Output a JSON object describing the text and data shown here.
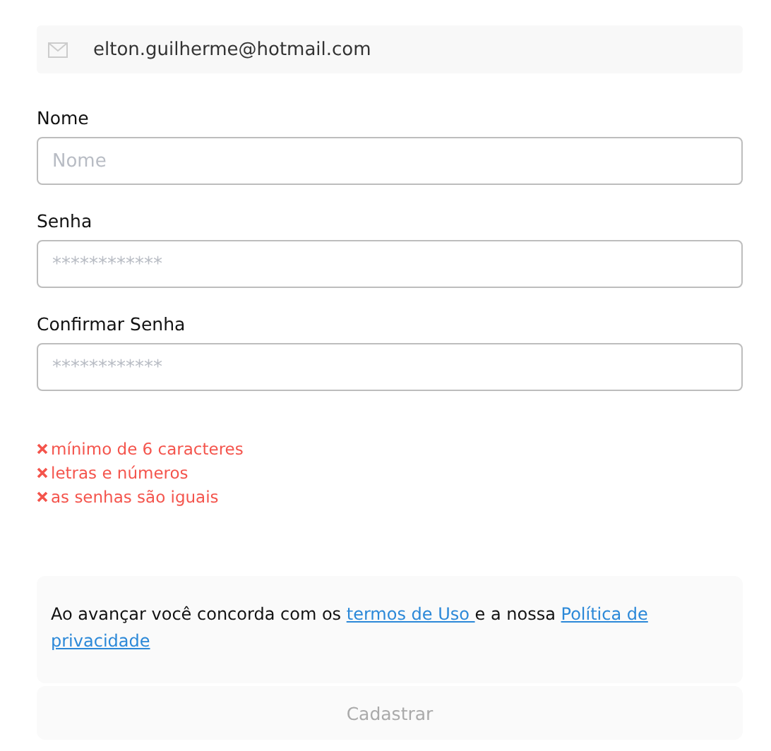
{
  "email": "elton.guilherme@hotmail.com",
  "fields": [
    {
      "label": "Nome",
      "placeholder": "Nome"
    },
    {
      "label": "Senha",
      "placeholder": "************"
    },
    {
      "label": "Confirmar Senha",
      "placeholder": "************"
    }
  ],
  "rules": [
    {
      "text": "mínimo de 6 caracteres",
      "met": false
    },
    {
      "text": "letras e números",
      "met": false
    },
    {
      "text": "as senhas são iguais",
      "met": false
    }
  ],
  "terms": {
    "before": "Ao avançar você concorda com os ",
    "link1": "termos de Uso ",
    "middle": "e a nossa ",
    "link2_parts": [
      "Política de",
      "privacidade"
    ]
  },
  "submit": {
    "label": "Cadastrar",
    "disabled": true
  }
}
